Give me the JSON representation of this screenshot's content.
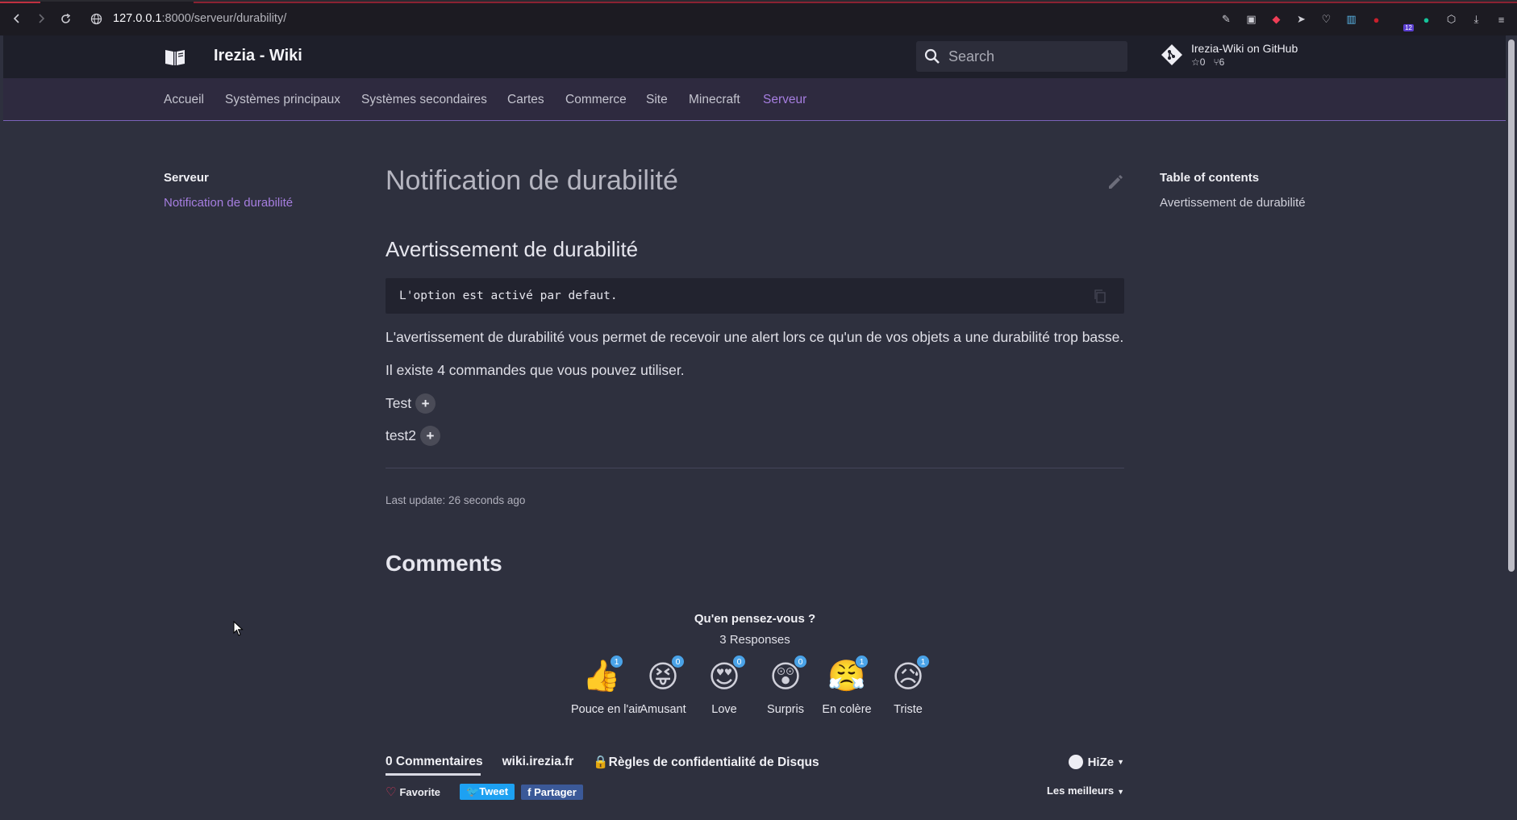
{
  "browser": {
    "url_host": "127.0.0.1",
    "url_rest": ":8000/serveur/durability/"
  },
  "header": {
    "site_title": "Irezia - Wiki",
    "search_placeholder": "Search",
    "repo_name": "Irezia-Wiki on GitHub",
    "repo_stars": "0",
    "repo_forks": "6"
  },
  "tabs": [
    {
      "label": "Accueil"
    },
    {
      "label": "Systèmes principaux"
    },
    {
      "label": "Systèmes secondaires"
    },
    {
      "label": "Cartes"
    },
    {
      "label": "Commerce"
    },
    {
      "label": "Site"
    },
    {
      "label": "Minecraft"
    },
    {
      "label": "Serveur",
      "active": true
    }
  ],
  "sidebar": {
    "section": "Serveur",
    "link": "Notification de durabilité"
  },
  "main": {
    "title": "Notification de durabilité",
    "heading": "Avertissement de durabilité",
    "code": "L'option est activé par defaut.",
    "para1": "L'avertissement de durabilité vous permet de recevoir une alert lors ce qu'un de vos objets a une durabilité trop basse.",
    "para2": "Il existe 4 commandes que vous pouvez utiliser.",
    "expand1": "Test",
    "expand2": "test2",
    "last_update": "Last update: 26 seconds ago",
    "comments_heading": "Comments"
  },
  "reactions": {
    "question": "Qu'en pensez-vous ?",
    "responses": "3 Responses",
    "items": [
      {
        "label": "Pouce en l'air",
        "count": "1",
        "emoji": "👍"
      },
      {
        "label": "Amusant",
        "count": "0",
        "emoji": "😝"
      },
      {
        "label": "Love",
        "count": "0",
        "emoji": "😍"
      },
      {
        "label": "Surpris",
        "count": "0",
        "emoji": "😲"
      },
      {
        "label": "En colère",
        "count": "1",
        "emoji": "😤"
      },
      {
        "label": "Triste",
        "count": "1",
        "emoji": "😥"
      }
    ]
  },
  "disqus": {
    "comments_tab": "0 Commentaires",
    "site_tab": "wiki.irezia.fr",
    "privacy": "Règles de confidentialité de Disqus",
    "user": "HiZe",
    "favorite": "Favorite",
    "tweet": "Tweet",
    "share": "Partager",
    "sort": "Les meilleurs"
  },
  "toc": {
    "title": "Table of contents",
    "link": "Avertissement de durabilité"
  },
  "colors": {
    "accent": "#a67ee0",
    "header_bg": "#1e1f2a",
    "tabs_bg": "#2e2a3f",
    "page_bg": "#2e303e"
  }
}
